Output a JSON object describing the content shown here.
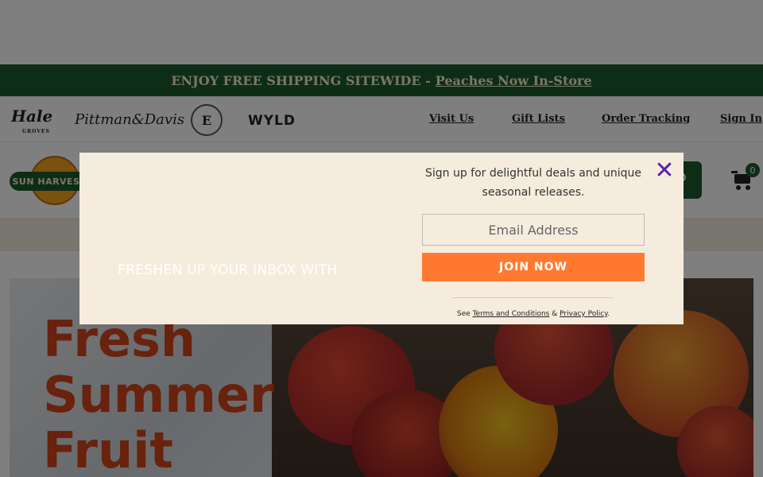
{
  "promo": {
    "text": "ENJOY FREE SHIPPING SITEWIDE -",
    "link": "Peaches Now In-Store"
  },
  "brands": {
    "hale": "Hale",
    "hale_sub": "GROVES",
    "pittman": "Pittman&Davis",
    "circle": "E",
    "wyld": "WYLD"
  },
  "nav": {
    "visit": "Visit Us",
    "gift": "Gift Lists",
    "tracking": "Order Tracking",
    "signin": "Sign In"
  },
  "header": {
    "logo_text": "SUN HARVEST",
    "cart_count": "0"
  },
  "hero": {
    "line1": "Fresh",
    "line2": "Summer",
    "line3": "Fruit"
  },
  "modal": {
    "headline": "FRESHEN UP YOUR INBOX WITH",
    "copy": "Sign up for delightful deals and unique seasonal releases.",
    "email_placeholder": "Email Address",
    "join_label": "JOIN NOW",
    "legal_prefix": "See",
    "terms_label": "Terms and Conditions",
    "legal_and": "&",
    "privacy_label": "Privacy Policy",
    "legal_suffix": ".",
    "close_glyph": "✕"
  },
  "colors": {
    "promo_green": "#1d5a2e",
    "join_orange": "#ff7a30",
    "close_purple": "#5a1fa8",
    "modal_bg": "#f6ecdd"
  }
}
